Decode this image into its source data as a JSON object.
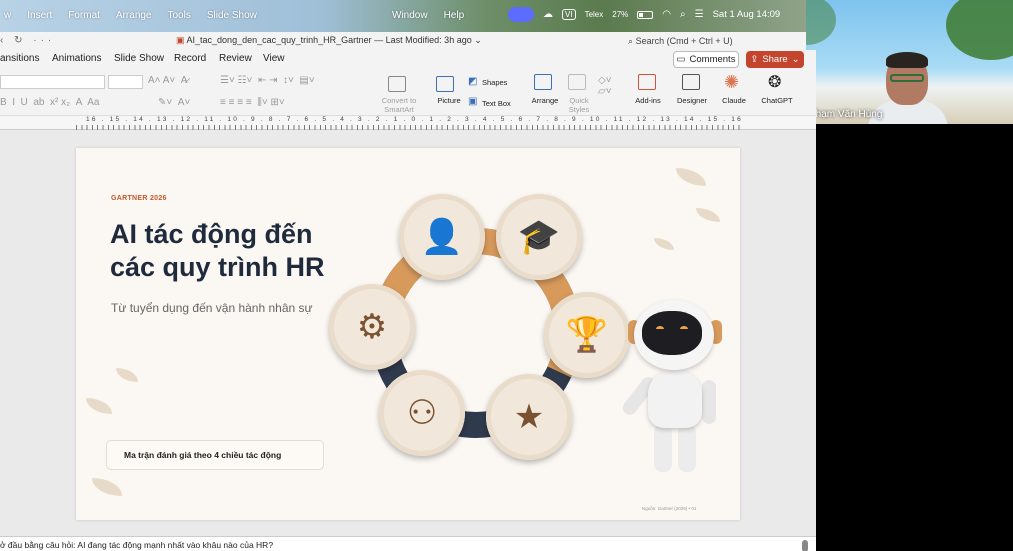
{
  "menubar": {
    "items": [
      "w",
      "Insert",
      "Format",
      "Arrange",
      "Tools",
      "Slide Show"
    ],
    "window": "Window",
    "help": "Help",
    "input_method": "VI",
    "input_label": "Telex",
    "battery": "27%",
    "datetime": "Sat 1 Aug  14:09"
  },
  "titlebar": {
    "document": "AI_tac_dong_den_cac_quy_trinh_HR_Gartner — Last Modified: 3h ago",
    "search_placeholder": "Search (Cmd + Ctrl + U)"
  },
  "tabs": [
    "ansitions",
    "Animations",
    "Slide Show",
    "Record",
    "Review",
    "View"
  ],
  "actions": {
    "comments": "Comments",
    "share": "Share"
  },
  "ribbon": {
    "convert_smartart": "Convert to SmartArt",
    "picture": "Picture",
    "shapes": "Shapes",
    "text_box": "Text Box",
    "arrange": "Arrange",
    "quick_styles": "Quick Styles",
    "add_ins": "Add-ins",
    "designer": "Designer",
    "claude": "Claude",
    "chatgpt": "ChatGPT"
  },
  "ruler": {
    "labels": "16 . 15 . 14 . 13 . 12 . 11 . 10 . 9 . 8 . 7 . 6 . 5 . 4 . 3 . 2 . 1 . 0 . 1 . 2 . 3 . 4 . 5 . 6 . 7 . 8 . 9 . 10 . 11 . 12 . 13 . 14 . 15 . 16"
  },
  "webcam": {
    "name": "Phạm Văn Hùng"
  },
  "slide": {
    "tag": "GARTNER 2026",
    "title_line1": "AI tác động đến",
    "title_line2": "các quy trình HR",
    "subtitle": "Từ tuyển dụng đến vận hành nhân sự",
    "caption": "Ma trận đánh giá theo 4 chiều tác động",
    "source": "Nguồn: Gartner (2026)  •  01"
  },
  "notes": {
    "text": "ở đầu bằng câu hỏi: AI đang tác động mạnh nhất vào khâu nào của HR?"
  },
  "colors": {
    "accent": "#c4582a",
    "ring_dark": "#2f3a4d",
    "ring_orange": "#d89a5b",
    "share": "#c4452d"
  },
  "icons": [
    "recruit-icon",
    "training-icon",
    "award-icon",
    "feedback-icon",
    "org-chart-icon",
    "process-icon"
  ]
}
